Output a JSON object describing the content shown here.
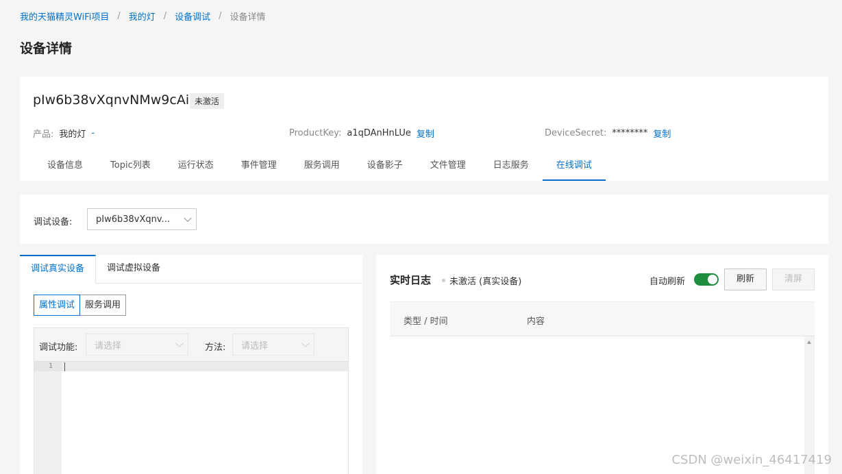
{
  "breadcrumb": {
    "items": [
      "我的天猫精灵WiFi项目",
      "我的灯",
      "设备调试"
    ],
    "current": "设备详情",
    "separator": "/"
  },
  "page_title": "设备详情",
  "device": {
    "name": "pIw6b38vXqnvNMw9cAil",
    "status_badge": "未激活",
    "product_label": "产品:",
    "product_value": "我的灯",
    "product_link": "-",
    "productkey_label": "ProductKey:",
    "productkey_value": "a1qDAnHnLUe",
    "productkey_copy": "复制",
    "secret_label": "DeviceSecret:",
    "secret_value": "********",
    "secret_copy": "复制"
  },
  "tabs": [
    {
      "label": "设备信息",
      "active": false
    },
    {
      "label": "Topic列表",
      "active": false
    },
    {
      "label": "运行状态",
      "active": false
    },
    {
      "label": "事件管理",
      "active": false
    },
    {
      "label": "服务调用",
      "active": false
    },
    {
      "label": "设备影子",
      "active": false
    },
    {
      "label": "文件管理",
      "active": false
    },
    {
      "label": "日志服务",
      "active": false
    },
    {
      "label": "在线调试",
      "active": true
    }
  ],
  "debug": {
    "device_label": "调试设备:",
    "device_selected": "pIw6b38vXqnv..."
  },
  "left_panel": {
    "subtabs": [
      "调试真实设备",
      "调试虚拟设备"
    ],
    "mode_buttons": [
      "属性调试",
      "服务调用"
    ],
    "function_label": "调试功能:",
    "function_placeholder": "请选择",
    "method_label": "方法:",
    "method_placeholder": "请选择",
    "line_number": "1"
  },
  "log": {
    "title": "实时日志",
    "status": "未激活 (真实设备)",
    "auto_refresh_label": "自动刷新",
    "auto_refresh_on": true,
    "refresh_button": "刷新",
    "clear_button": "清屏",
    "columns": [
      "类型 / 时间",
      "内容"
    ]
  },
  "watermark": "CSDN @weixin_46417419",
  "colors": {
    "accent": "#0070cc",
    "toggle_on": "#1e8e3e",
    "background": "#f5f5f5"
  }
}
